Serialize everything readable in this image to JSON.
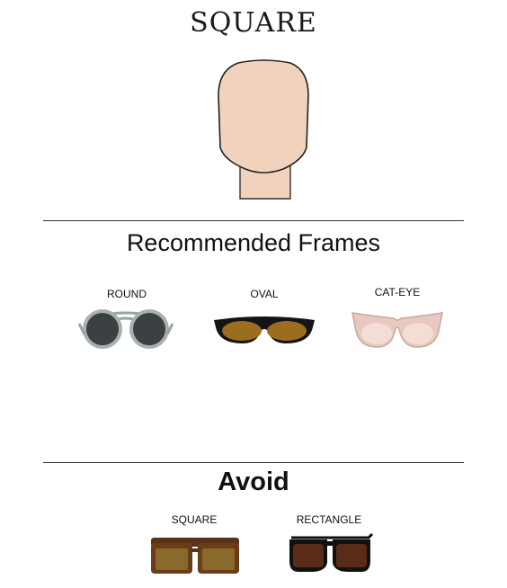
{
  "title": "SQUARE",
  "recommended": {
    "heading": "Recommended Frames",
    "frames": [
      {
        "label": "ROUND",
        "icon": "round-glasses-icon"
      },
      {
        "label": "OVAL",
        "icon": "oval-sunglasses-icon"
      },
      {
        "label": "CAT-EYE",
        "icon": "cat-eye-sunglasses-icon"
      }
    ]
  },
  "avoid": {
    "heading": "Avoid",
    "frames": [
      {
        "label": "SQUARE",
        "icon": "square-sunglasses-icon"
      },
      {
        "label": "RECTANGLE",
        "icon": "rectangle-sunglasses-icon"
      }
    ]
  },
  "colors": {
    "skin": "#f0d2bd",
    "text": "#111111"
  }
}
